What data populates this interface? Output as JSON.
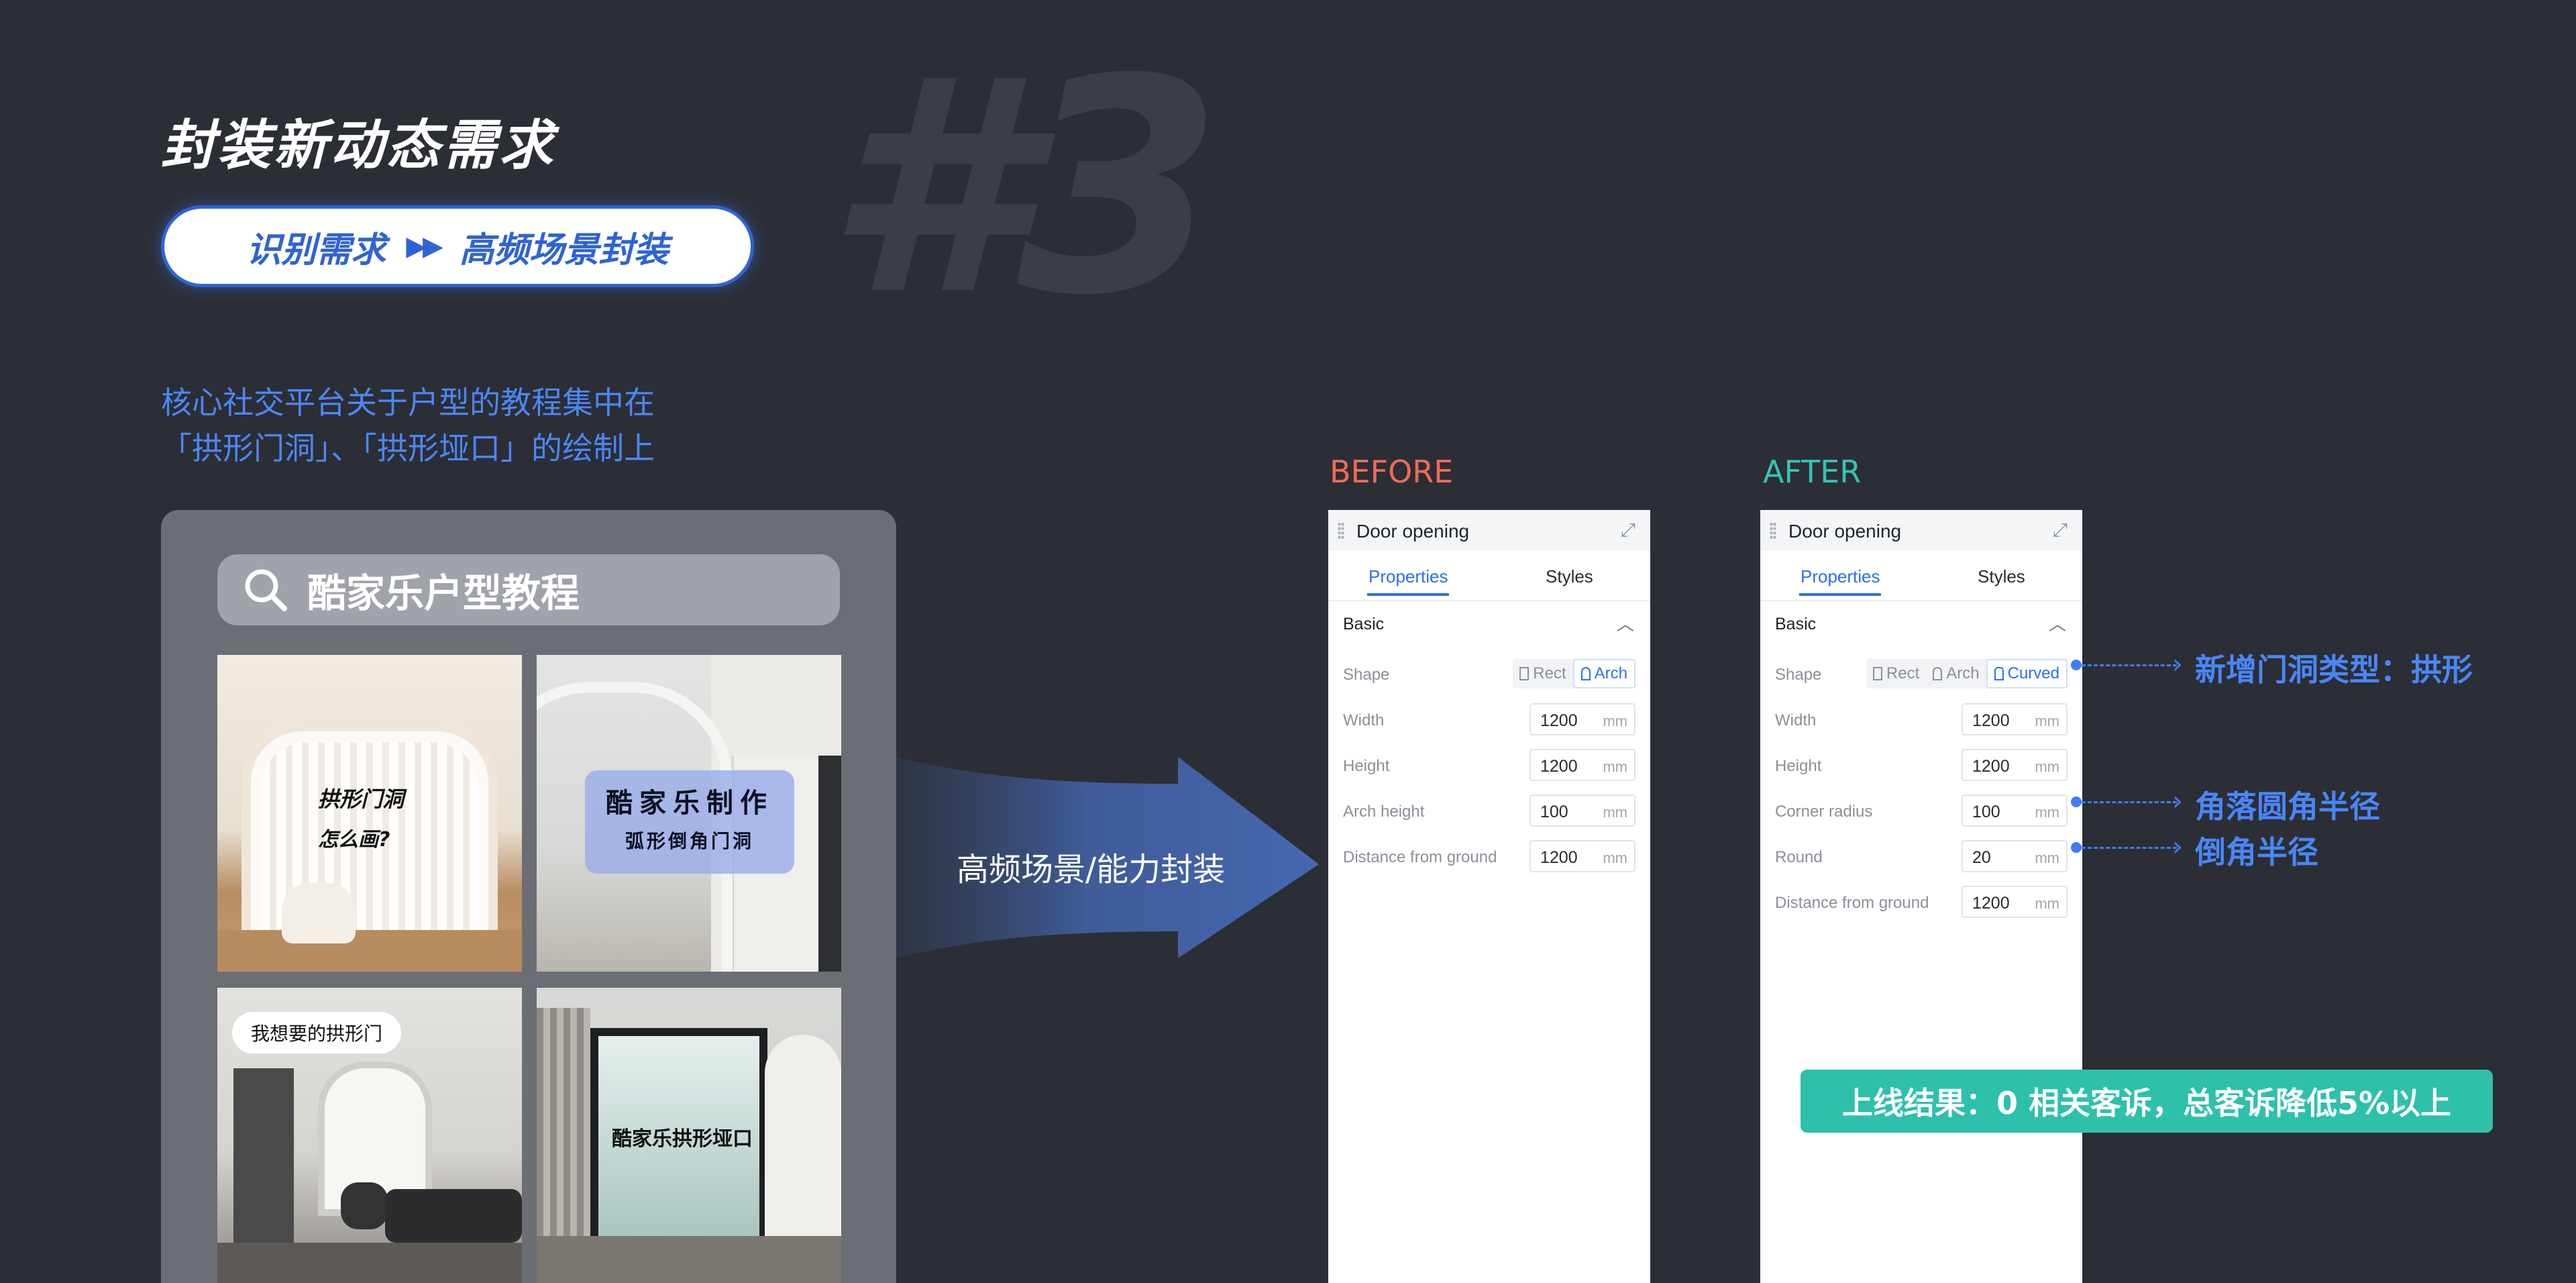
{
  "header": {
    "title": "封装新动态需求",
    "number": "#3",
    "pill_left": "识别需求",
    "pill_arrows": "▶▶",
    "pill_right": "高频场景封装"
  },
  "description": {
    "line1": "核心社交平台关于户型的教程集中在",
    "line2": "「拱形门洞」、「拱形垭口」的绘制上"
  },
  "phone": {
    "search_text": "酷家乐户型教程",
    "tile1_line1": "拱形门洞",
    "tile1_line2": "怎么画?",
    "tile2_line1": "酷家乐制作",
    "tile2_line2": "弧形倒角门洞",
    "tile3_bubble": "我想要的拱形门",
    "tile4_text": "酷家乐拱形垭口"
  },
  "arrow_label": "高频场景/能力封装",
  "before": {
    "label": "BEFORE",
    "panel_title": "Door opening",
    "tab_properties": "Properties",
    "tab_styles": "Styles",
    "section": "Basic",
    "shape_label": "Shape",
    "shape_options": [
      "Rect",
      "Arch"
    ],
    "shape_selected": "Arch",
    "rows": [
      {
        "label": "Width",
        "value": "1200",
        "unit": "mm"
      },
      {
        "label": "Height",
        "value": "1200",
        "unit": "mm"
      },
      {
        "label": "Arch height",
        "value": "100",
        "unit": "mm"
      },
      {
        "label": "Distance from ground",
        "value": "1200",
        "unit": "mm"
      }
    ]
  },
  "after": {
    "label": "AFTER",
    "panel_title": "Door opening",
    "tab_properties": "Properties",
    "tab_styles": "Styles",
    "section": "Basic",
    "shape_label": "Shape",
    "shape_options": [
      "Rect",
      "Arch",
      "Curved"
    ],
    "shape_selected": "Curved",
    "rows": [
      {
        "label": "Width",
        "value": "1200",
        "unit": "mm"
      },
      {
        "label": "Height",
        "value": "1200",
        "unit": "mm"
      },
      {
        "label": "Corner radius",
        "value": "100",
        "unit": "mm"
      },
      {
        "label": "Round",
        "value": "20",
        "unit": "mm"
      },
      {
        "label": "Distance from ground",
        "value": "1200",
        "unit": "mm"
      }
    ]
  },
  "annotations": {
    "shape": "新增门洞类型：拱形",
    "corner_radius": "角落圆角半径",
    "round": "倒角半径"
  },
  "result": "上线结果：0 相关客诉，总客诉降低5%以上",
  "colors": {
    "background": "#2b2e35",
    "accent_blue": "#2f63d4",
    "link_blue": "#2b6ef5",
    "before_red": "#ef6b57",
    "after_teal": "#35c4b2",
    "result_teal": "#2ec0ab"
  }
}
